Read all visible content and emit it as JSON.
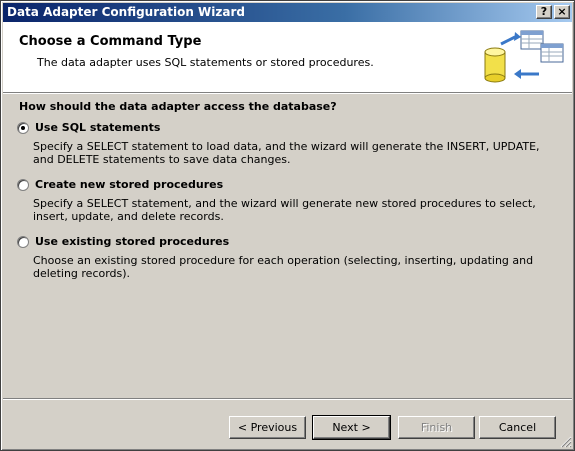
{
  "window": {
    "title": "Data Adapter Configuration Wizard",
    "help_label": "?",
    "close_label": "×"
  },
  "header": {
    "title": "Choose a Command Type",
    "subtitle": "The data adapter uses SQL statements or stored procedures."
  },
  "question": "How should the data adapter access the database?",
  "options": [
    {
      "label": "Use SQL statements",
      "description": "Specify a SELECT statement to load data, and the wizard will generate the INSERT, UPDATE, and DELETE statements to save data changes.",
      "selected": true
    },
    {
      "label": "Create new stored procedures",
      "description": "Specify a SELECT statement, and the wizard will generate new stored procedures to select, insert, update, and delete records.",
      "selected": false
    },
    {
      "label": "Use existing stored procedures",
      "description": "Choose an existing stored procedure for each operation (selecting, inserting, updating and deleting records).",
      "selected": false
    }
  ],
  "buttons": {
    "previous": "< Previous",
    "next": "Next >",
    "finish": "Finish",
    "cancel": "Cancel"
  },
  "icons": {
    "header": "database-tables-icon",
    "help": "help-icon",
    "close": "close-icon",
    "grip": "resize-grip-icon"
  },
  "colors": {
    "titlebar_start": "#0a246a",
    "titlebar_end": "#a6caf0",
    "dialog_bg": "#d4d0c8",
    "header_bg": "#ffffff"
  }
}
